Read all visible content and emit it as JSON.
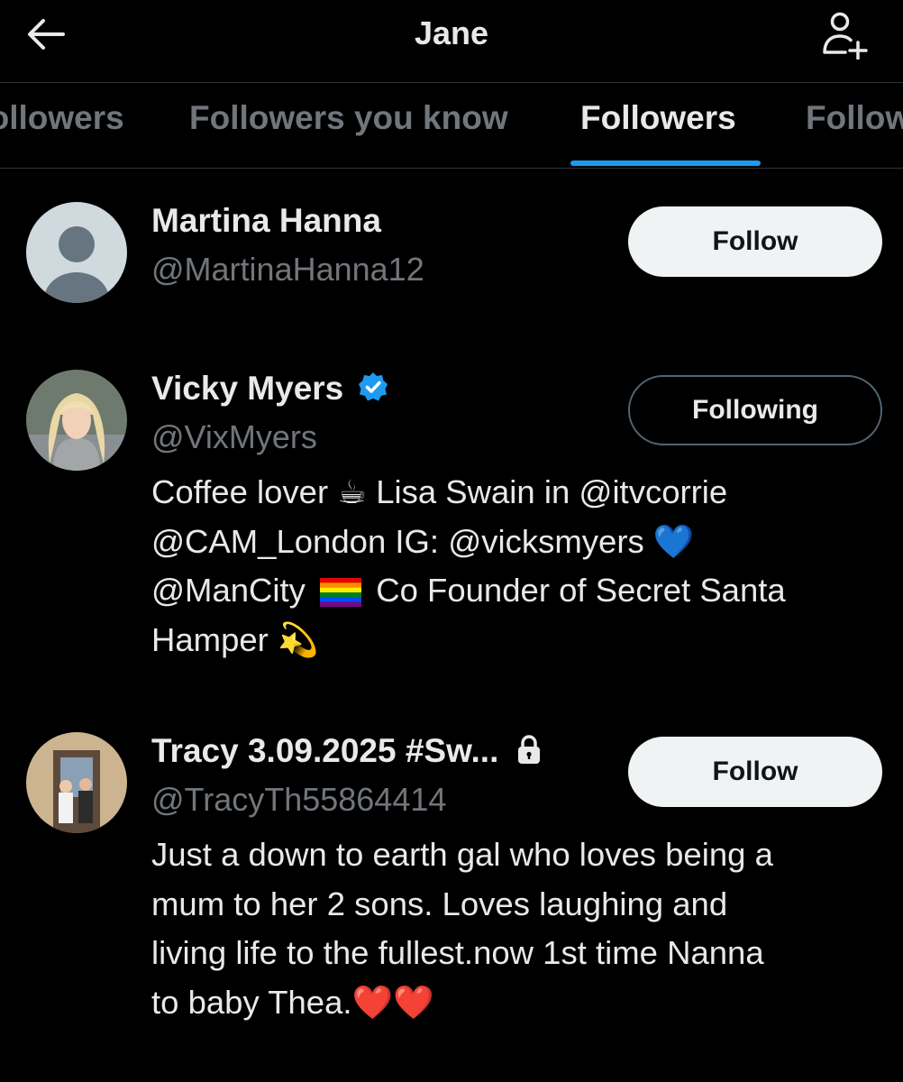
{
  "header": {
    "title": "Jane",
    "back_icon": "arrow-left-icon",
    "add_icon": "person-add-icon"
  },
  "tabs": [
    {
      "label": "Followers"
    },
    {
      "label": "Followers you know"
    },
    {
      "label": "Followers",
      "active": true
    },
    {
      "label": "Following"
    }
  ],
  "users": [
    {
      "name": "Martina Hanna",
      "handle": "@MartinaHanna12",
      "button": "Follow",
      "avatar": "default-avatar-icon"
    },
    {
      "name": "Vicky Myers",
      "verified": true,
      "handle": "@VixMyers",
      "button": "Following",
      "bio": {
        "line1_a": "Coffee lover",
        "line1_emoji": "☕",
        "line1_b": "Lisa Swain in @itvcorrie",
        "line2_a": "@CAM_London IG: @vicksmyers",
        "line2_emoji": "💙",
        "line3_a": "@ManCity",
        "line3_b": "Co Founder of Secret Santa",
        "line4_a": "Hamper",
        "line4_emoji": "💫"
      }
    },
    {
      "name": "Tracy 3.09.2025 #Sw...",
      "locked": true,
      "handle": "@TracyTh55864414",
      "button": "Follow",
      "bio": {
        "line1": "Just a down to earth gal who loves being a",
        "line2": "mum to her 2 sons. Loves laughing and",
        "line3": "living life to the fullest.now 1st time Nanna",
        "line4_a": "to baby Thea.",
        "line4_emoji": "❤️❤️"
      }
    }
  ],
  "colors": {
    "background": "#000000",
    "text": "#e7e9ea",
    "muted": "#71767b",
    "accent": "#1d9bf0",
    "follow_button_bg": "#eff3f4",
    "following_border": "#536471"
  }
}
